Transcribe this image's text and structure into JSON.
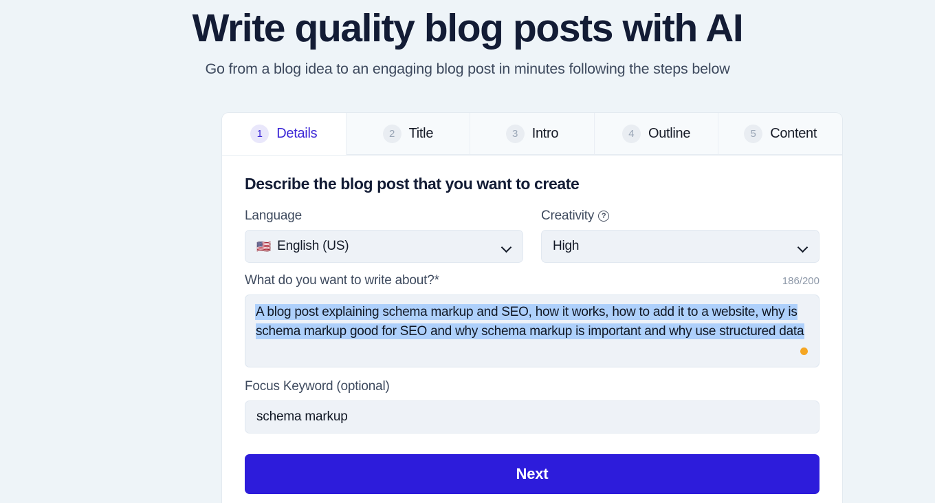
{
  "hero": {
    "title": "Write quality blog posts with AI",
    "subtitle": "Go from a blog idea to an engaging blog post in minutes following the steps below"
  },
  "tabs": [
    {
      "number": "1",
      "label": "Details",
      "active": true
    },
    {
      "number": "2",
      "label": "Title",
      "active": false
    },
    {
      "number": "3",
      "label": "Intro",
      "active": false
    },
    {
      "number": "4",
      "label": "Outline",
      "active": false
    },
    {
      "number": "5",
      "label": "Content",
      "active": false
    }
  ],
  "form": {
    "section_title": "Describe the blog post that you want to create",
    "language": {
      "label": "Language",
      "flag": "🇺🇸",
      "value": "English (US)",
      "options": [
        "English (US)"
      ]
    },
    "creativity": {
      "label": "Creativity",
      "help_icon": "?",
      "value": "High",
      "options": [
        "High"
      ]
    },
    "topic": {
      "label": "What do you want to write about?*",
      "counter": "186/200",
      "value_selected": "A blog post explaining schema markup and SEO, how it works, how to add it to a website, why is schema markup good for SEO and  why schema markup is important and why use structured data",
      "indicator_color": "#f5a623"
    },
    "focus_keyword": {
      "label": "Focus Keyword (optional)",
      "value": "schema markup",
      "placeholder": "schema markup"
    },
    "next_button": "Next"
  },
  "colors": {
    "accent": "#2d1cdb",
    "active_tab_text": "#3b27d6",
    "page_background": "#eef4f8",
    "indicator": "#f5a623",
    "selection": "#aed0fb"
  }
}
